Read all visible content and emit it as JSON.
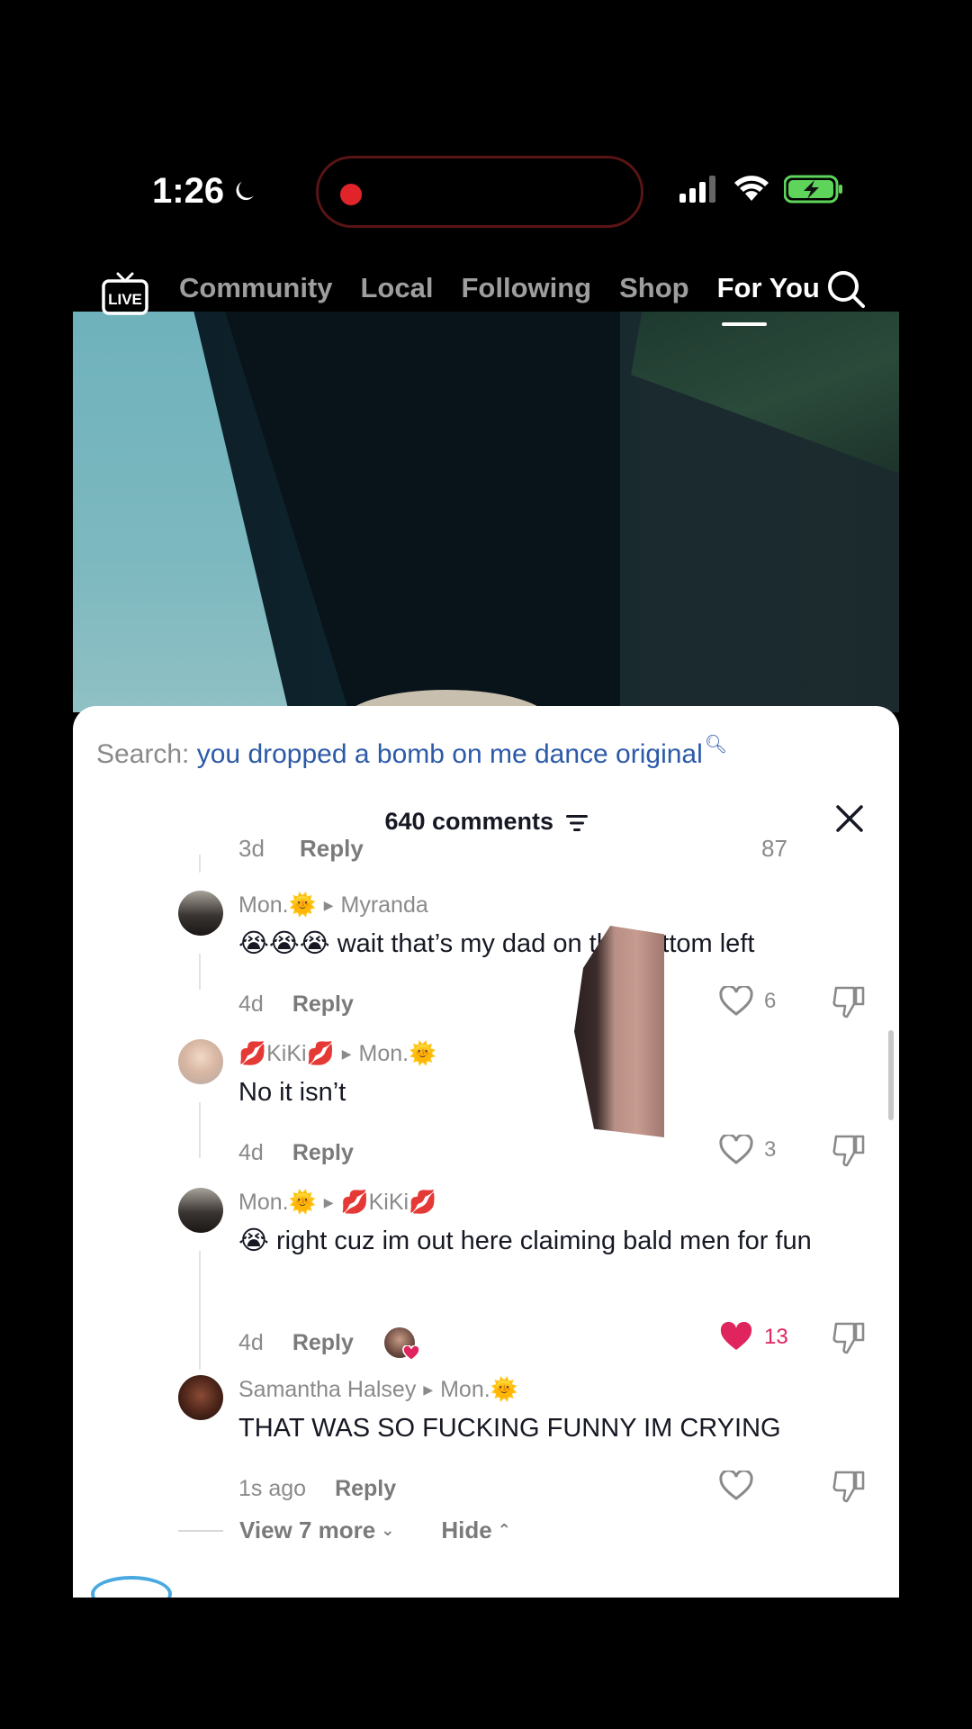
{
  "status_bar": {
    "time": "1:26",
    "moon_icon": "moon-icon",
    "signal_icon": "cellular-signal-icon",
    "wifi_icon": "wifi-icon",
    "battery_icon": "battery-charging-icon"
  },
  "nav": {
    "live_label": "LIVE",
    "tabs": [
      "Community",
      "Local",
      "Following",
      "Shop",
      "For You"
    ],
    "active_tab": "For You"
  },
  "sheet": {
    "search_label": "Search:",
    "search_query": "you dropped a bomb on me dance original",
    "comment_count": "640 comments",
    "cut_row": {
      "time": "3d",
      "reply": "Reply",
      "likes": "87"
    }
  },
  "comments": [
    {
      "author": "Mon.🌞",
      "reply_to": "Myranda",
      "text": "😭😭😭 wait that’s my dad on the bottom left",
      "time": "4d",
      "reply": "Reply",
      "likes": "6",
      "liked": false
    },
    {
      "author": "💋KiKi💋",
      "reply_to": "Mon.🌞",
      "text": "No it isn’t",
      "time": "4d",
      "reply": "Reply",
      "likes": "3",
      "liked": false
    },
    {
      "author": "Mon.🌞",
      "reply_to": "💋KiKi💋",
      "text": "😭 right cuz im out here claiming bald men for fun",
      "time": "4d",
      "reply": "Reply",
      "likes": "13",
      "liked": true
    },
    {
      "author": "Samantha Halsey",
      "reply_to": "Mon.🌞",
      "text": "THAT WAS SO FUCKING FUNNY IM CRYING",
      "time": "1s ago",
      "reply": "Reply",
      "likes": "",
      "liked": false
    }
  ],
  "footer": {
    "view_more": "View 7 more",
    "hide": "Hide"
  },
  "colors": {
    "link_blue": "#2c5aa8",
    "like_red": "#e0245e",
    "muted": "#8a8a8a"
  }
}
